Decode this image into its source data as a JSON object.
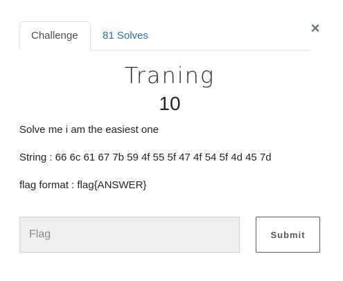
{
  "modal": {
    "close_label": "×",
    "tabs": [
      {
        "label": "Challenge",
        "active": true
      },
      {
        "label": "81 Solves",
        "active": false
      }
    ],
    "challenge": {
      "name": "Traning",
      "value": "10",
      "description": [
        "Solve me i am the easiest one",
        "String : 66 6c 61 67 7b 59 4f 55 5f 47 4f 54 5f 4d 45 7d",
        "flag format : flag{ANSWER}"
      ]
    },
    "flag_input": {
      "placeholder": "Flag",
      "value": ""
    },
    "submit_label": "Submit"
  },
  "colors": {
    "tab_link": "#2a6faa",
    "input_bg": "#efefef",
    "button_border": "#5a5a5a"
  }
}
